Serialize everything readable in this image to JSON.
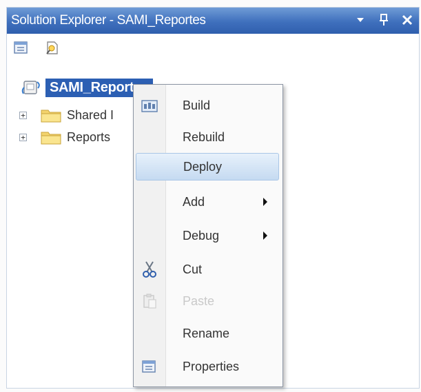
{
  "window": {
    "title": "Solution Explorer - SAMI_Reportes"
  },
  "toolbar": {
    "buttons": [
      {
        "icon": "properties-icon"
      },
      {
        "icon": "show-all-files-icon"
      }
    ]
  },
  "tree": {
    "root": {
      "label": "SAMI_Reportes",
      "icon": "solution-project-icon"
    },
    "nodes": [
      {
        "label": "Shared I",
        "icon": "folder-icon",
        "expander": "+"
      },
      {
        "label": "Reports",
        "icon": "folder-icon",
        "expander": "+"
      }
    ]
  },
  "context_menu": {
    "items": [
      {
        "label": "Build",
        "icon": "build-icon",
        "enabled": true
      },
      {
        "label": "Rebuild",
        "enabled": true
      },
      {
        "label": "Deploy",
        "enabled": true,
        "highlighted": true
      },
      {
        "label": "Add",
        "enabled": true,
        "submenu": true
      },
      {
        "label": "Debug",
        "enabled": true,
        "submenu": true
      },
      {
        "label": "Cut",
        "icon": "cut-icon",
        "enabled": true
      },
      {
        "label": "Paste",
        "icon": "paste-icon",
        "enabled": false
      },
      {
        "label": "Rename",
        "enabled": true
      },
      {
        "label": "Properties",
        "icon": "properties-icon",
        "enabled": true
      }
    ]
  },
  "colors": {
    "titlebar": "#3f70bd",
    "selection": "#2c5fb3",
    "menu_highlight": "#c5daf1"
  }
}
